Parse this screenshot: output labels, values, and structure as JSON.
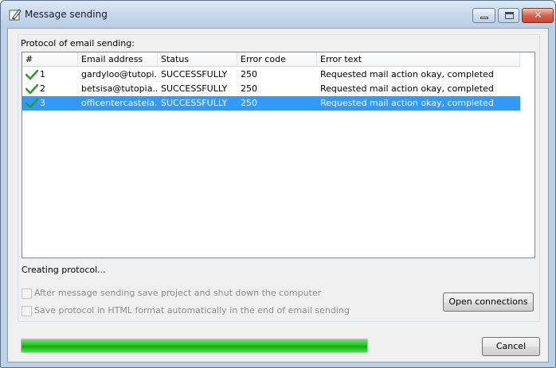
{
  "window": {
    "title": "Message sending",
    "icon": "pencil-edit-icon"
  },
  "group": {
    "label": "Protocol of email sending:"
  },
  "table": {
    "columns": [
      "#",
      "Email address",
      "Status",
      "Error code",
      "Error text"
    ],
    "rows": [
      {
        "num": "1",
        "email": "gardyloo@tutopi...",
        "status": "SUCCESSFULLY",
        "code": "250",
        "text": "Requested mail action okay, completed",
        "icon": "green-checkmark-icon"
      },
      {
        "num": "2",
        "email": "betsisa@tutopia....",
        "status": "SUCCESSFULLY",
        "code": "250",
        "text": "Requested mail action okay, completed",
        "icon": "green-checkmark-icon"
      },
      {
        "num": "3",
        "email": "officentercastela...",
        "status": "SUCCESSFULLY",
        "code": "250",
        "text": "Requested mail action okay, completed",
        "icon": "green-checkmark-icon"
      }
    ],
    "selected_row": 3
  },
  "status_text": "Creating protocol...",
  "options": {
    "shutdown_label": "After message sending save project and shut down the computer",
    "shutdown_checked": false,
    "save_html_label": "Save protocol in HTML format automatically in the end of email sending",
    "save_html_checked": false
  },
  "buttons": {
    "open_connections": "Open connections",
    "cancel": "Cancel"
  },
  "progress": {
    "fraction": 1.0
  },
  "colors": {
    "selection": "#3399ff",
    "progress": "#1fc51f",
    "check": "#2e9a2e"
  }
}
